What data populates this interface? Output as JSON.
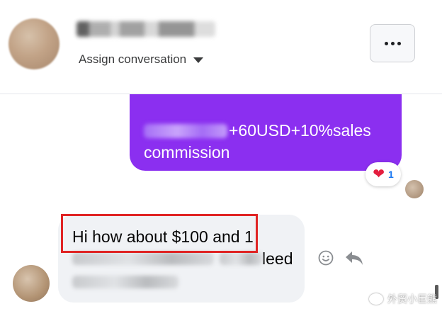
{
  "header": {
    "assign_label": "Assign conversation",
    "more_label": "More options"
  },
  "messages": {
    "sent": {
      "line1_visible": "+60USD+10%sales",
      "line2": "commission",
      "reaction": {
        "emoji": "❤",
        "count": "1"
      }
    },
    "received": {
      "line1": "Hi how about $100 and 1",
      "line2_visible": "leed"
    }
  },
  "watermark": {
    "text": "外贸小巨熊"
  },
  "colors": {
    "sent_bubble": "#8b2ff0",
    "received_bubble": "#f0f2f5",
    "highlight": "#e02424",
    "reaction_count": "#1877f2"
  }
}
